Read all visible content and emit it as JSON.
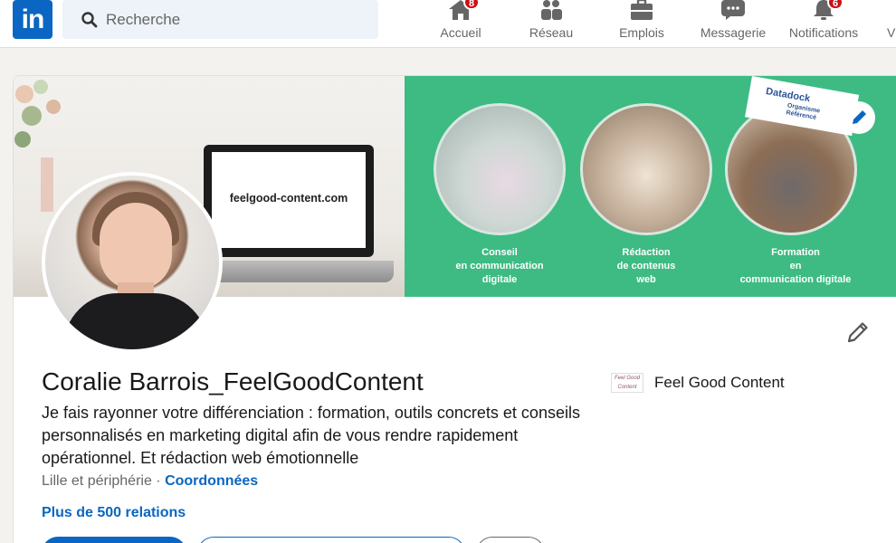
{
  "nav": {
    "search_placeholder": "Recherche",
    "items": [
      {
        "label": "Accueil",
        "icon": "home-icon",
        "badge": "8"
      },
      {
        "label": "Réseau",
        "icon": "network-icon",
        "badge": ""
      },
      {
        "label": "Emplois",
        "icon": "briefcase-icon",
        "badge": ""
      },
      {
        "label": "Messagerie",
        "icon": "messaging-icon",
        "badge": ""
      },
      {
        "label": "Notifications",
        "icon": "bell-icon",
        "badge": "6"
      },
      {
        "label": "V",
        "icon": "",
        "badge": ""
      }
    ]
  },
  "banner": {
    "url_text": "feelgood-content.com",
    "services": [
      {
        "line1": "Conseil",
        "line2": "en communication",
        "line3": "digitale"
      },
      {
        "line1": "Rédaction",
        "line2": "de contenus",
        "line3": "web"
      },
      {
        "line1": "Formation",
        "line2": "en",
        "line3": "communication digitale"
      }
    ],
    "badge_title": "Datadock",
    "badge_sub1": "Organisme",
    "badge_sub2": "Référencé"
  },
  "profile": {
    "name": "Coralie Barrois_FeelGoodContent",
    "headline": "Je fais rayonner votre différenciation : formation, outils concrets et conseils personnalisés en marketing digital afin de vous rendre rapidement opérationnel. Et rédaction web émotionnelle",
    "location": "Lille et périphérie · ",
    "contact_link": "Coordonnées",
    "connections": "Plus de 500 relations",
    "company": "Feel Good Content",
    "company_logo_text": "Feel Good Content"
  },
  "colors": {
    "brand": "#0a66c2",
    "banner_green": "#3dbb83",
    "badge_red": "#cc1016"
  }
}
